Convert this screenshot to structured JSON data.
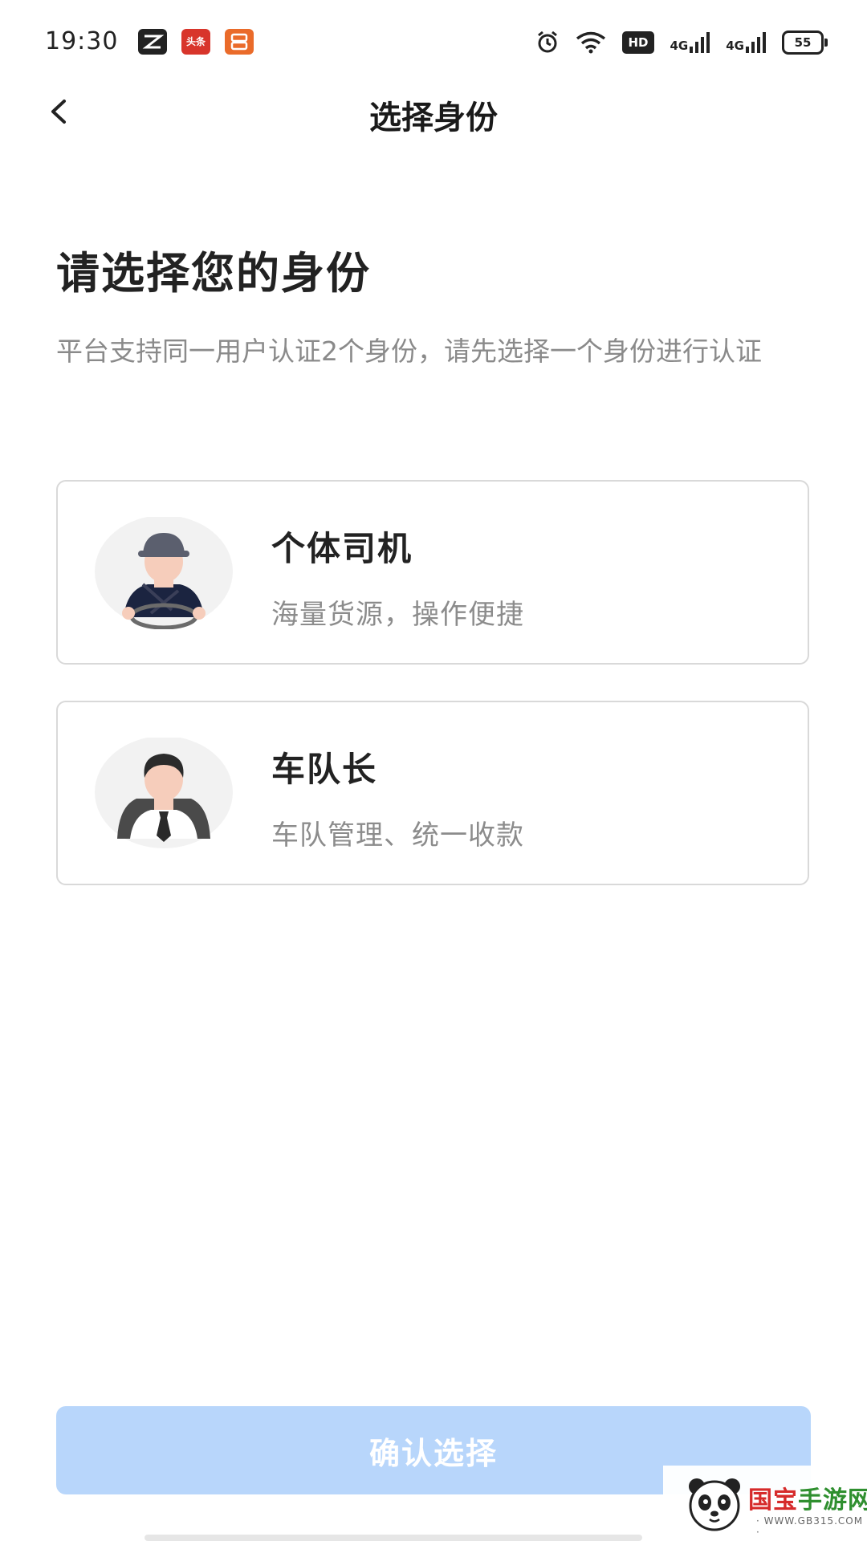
{
  "status_bar": {
    "time": "19:30",
    "apps": [
      "CapCut",
      "头条",
      "淘宝"
    ],
    "hd_label": "HD",
    "signal_1": "4G",
    "signal_2": "4G",
    "battery": "55"
  },
  "nav": {
    "back_icon": "chevron-left-icon",
    "title": "选择身份"
  },
  "heading": "请选择您的身份",
  "description": "平台支持同一用户认证2个身份，请先选择一个身份进行认证",
  "options": [
    {
      "title": "个体司机",
      "subtitle": "海量货源，操作便捷",
      "icon": "driver-avatar-icon"
    },
    {
      "title": "车队长",
      "subtitle": "车队管理、统一收款",
      "icon": "fleet-leader-avatar-icon"
    }
  ],
  "confirm_button": "确认选择",
  "watermark": {
    "text_red": "国宝",
    "text_green": "手游网",
    "url": "· WWW.GB315.COM ·"
  },
  "colors": {
    "primary_disabled": "#b8d6fb",
    "card_border": "#d9d9d9",
    "secondary_text": "#8a8a8a"
  }
}
